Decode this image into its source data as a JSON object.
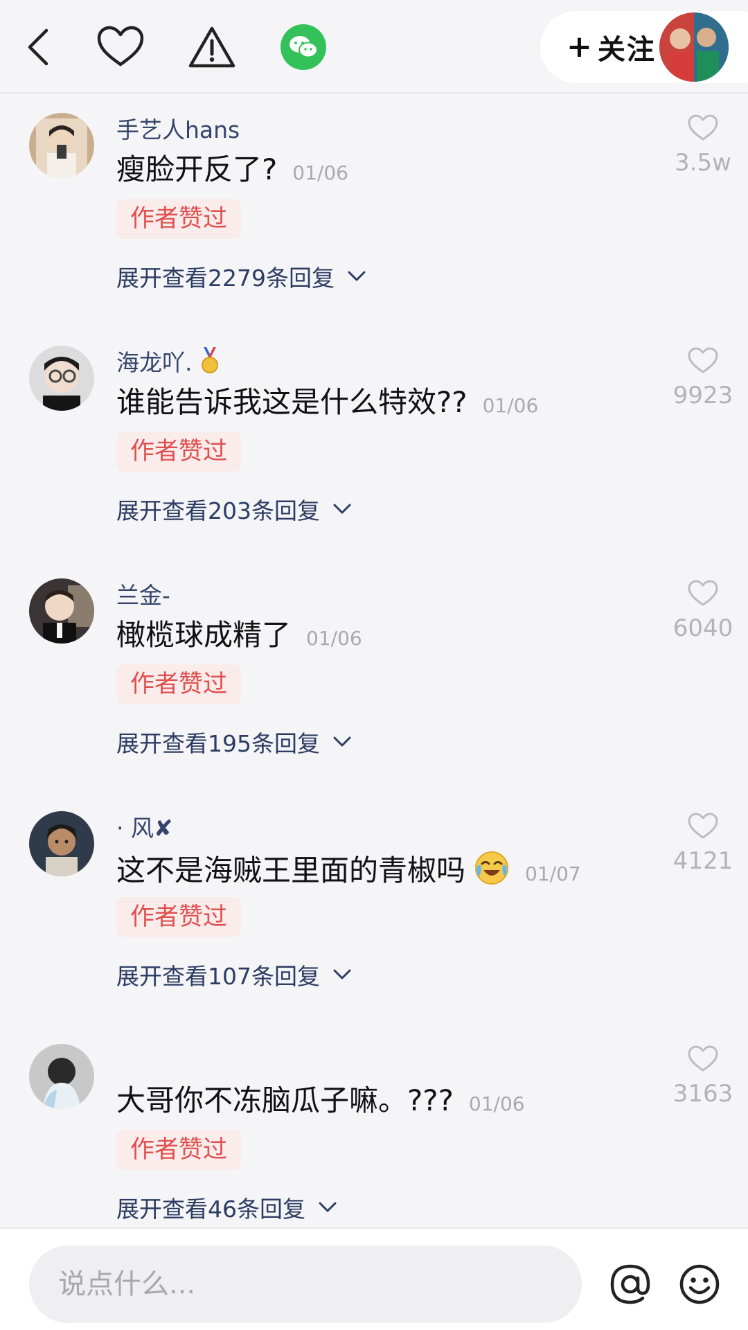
{
  "header": {
    "back_icon": "chevron-left-icon",
    "like_icon": "heart-outline-icon",
    "report_icon": "warning-triangle-icon",
    "share_icon": "wechat-icon",
    "follow_label": "关注",
    "follow_plus": "+"
  },
  "comments": [
    {
      "username": "手艺人hans",
      "content": "瘦脸开反了?",
      "date": "01/06",
      "badge": "作者赞过",
      "expand": "展开查看2279条回复",
      "likes": "3.5w"
    },
    {
      "username": "海龙吖.",
      "username_icon": "medal-icon",
      "content": "谁能告诉我这是什么特效??",
      "date": "01/06",
      "badge": "作者赞过",
      "expand": "展开查看203条回复",
      "likes": "9923"
    },
    {
      "username": "兰金-",
      "content": "橄榄球成精了",
      "date": "01/06",
      "badge": "作者赞过",
      "expand": "展开查看195条回复",
      "likes": "6040"
    },
    {
      "username": "· 风✘",
      "content": "这不是海贼王里面的青椒吗",
      "content_icon": "laugh-cry-emoji-icon",
      "date": "01/07",
      "badge": "作者赞过",
      "expand": "展开查看107条回复",
      "likes": "4121"
    },
    {
      "username": "",
      "content": "大哥你不冻脑瓜子嘛。???",
      "date": "01/06",
      "badge": "作者赞过",
      "expand": "展开查看46条回复",
      "likes": "3163"
    }
  ],
  "footer": {
    "input_placeholder": "说点什么...",
    "at_icon": "at-sign-icon",
    "emoji_icon": "smiley-icon"
  },
  "colors": {
    "background": "#f5f5f7",
    "username": "#34446a",
    "badge_text": "#e0504f",
    "badge_bg": "#fbecec",
    "wechat_green": "#33c15a",
    "like_gray": "#b3b3b3"
  }
}
